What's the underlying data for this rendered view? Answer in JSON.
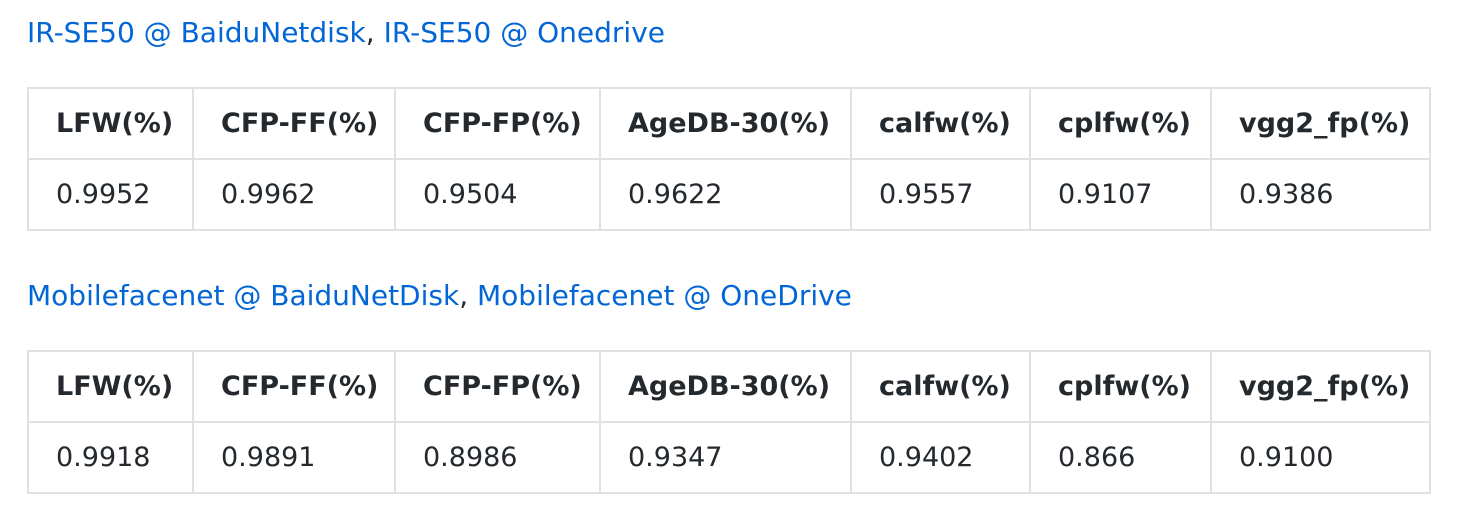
{
  "columns": [
    "LFW(%)",
    "CFP-FF(%)",
    "CFP-FP(%)",
    "AgeDB-30(%)",
    "calfw(%)",
    "cplfw(%)",
    "vgg2_fp(%)"
  ],
  "sections": [
    {
      "link1": "IR-SE50 @ BaiduNetdisk",
      "separator": ", ",
      "link2": "IR-SE50 @ Onedrive",
      "values": [
        "0.9952",
        "0.9962",
        "0.9504",
        "0.9622",
        "0.9557",
        "0.9107",
        "0.9386"
      ]
    },
    {
      "link1": "Mobilefacenet @ BaiduNetDisk",
      "separator": ", ",
      "link2": "Mobilefacenet @ OneDrive",
      "values": [
        "0.9918",
        "0.9891",
        "0.8986",
        "0.9347",
        "0.9402",
        "0.866",
        "0.9100"
      ]
    }
  ],
  "colors": {
    "link": "#0366d6",
    "text": "#24292e",
    "border": "#dfe2e5"
  }
}
